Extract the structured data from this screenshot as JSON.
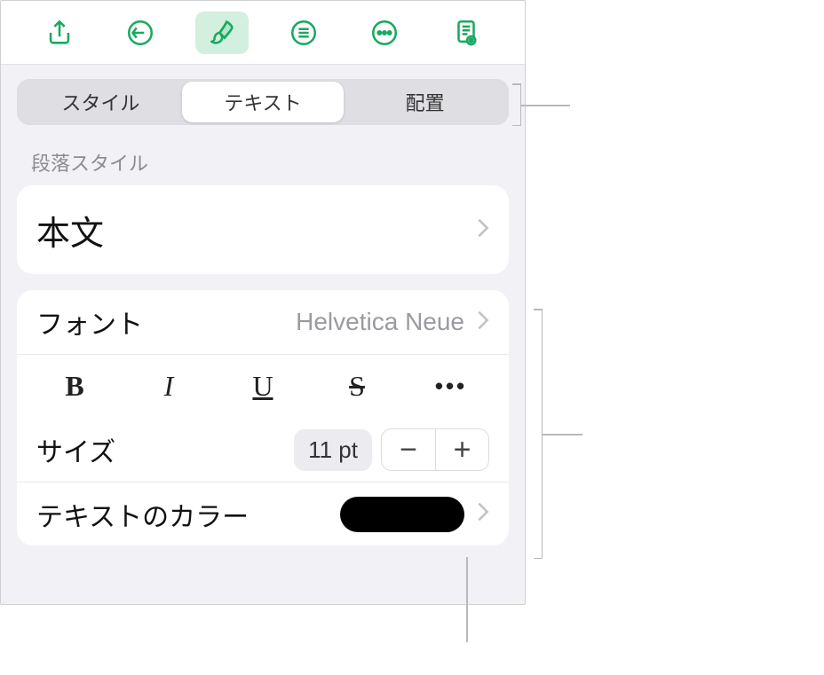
{
  "toolbar": {
    "share_icon": "share",
    "undo_icon": "undo",
    "format_icon": "brush",
    "list_icon": "list",
    "more_icon": "more",
    "view_icon": "document-view"
  },
  "tabs": {
    "style": "スタイル",
    "text": "テキスト",
    "arrange": "配置"
  },
  "paragraph_style": {
    "label": "段落スタイル",
    "value": "本文"
  },
  "font": {
    "label": "フォント",
    "value": "Helvetica Neue"
  },
  "style_buttons": {
    "bold": "B",
    "italic": "I",
    "underline": "U",
    "strike": "S",
    "more": "•••"
  },
  "size": {
    "label": "サイズ",
    "value": "11 pt",
    "minus": "−",
    "plus": "+"
  },
  "text_color": {
    "label": "テキストのカラー",
    "swatch": "#000000"
  }
}
